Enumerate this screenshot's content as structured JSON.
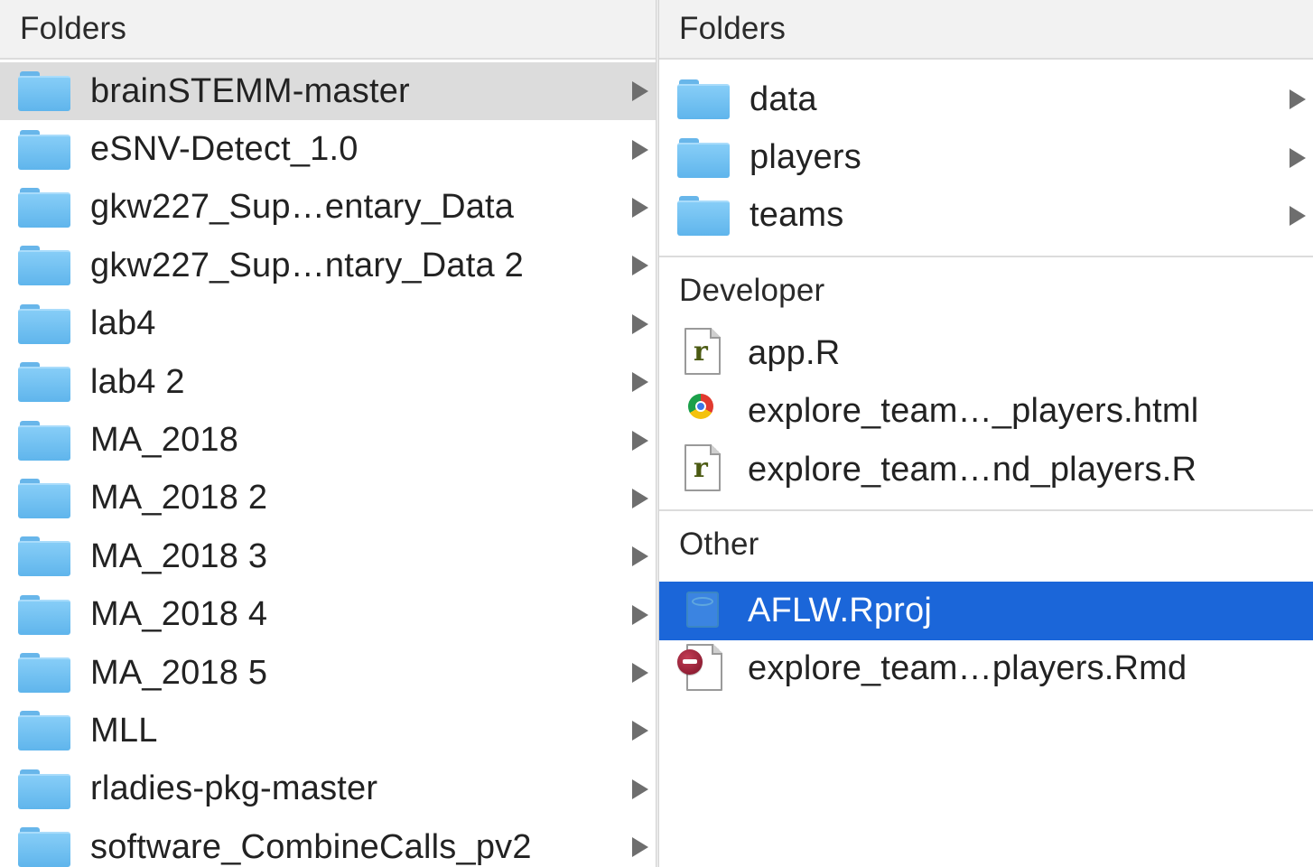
{
  "left_column": {
    "header": "Folders",
    "items": [
      {
        "label": "brainSTEMM-master",
        "selected": true
      },
      {
        "label": "eSNV-Detect_1.0"
      },
      {
        "label": "gkw227_Sup…entary_Data"
      },
      {
        "label": "gkw227_Sup…ntary_Data 2"
      },
      {
        "label": "lab4"
      },
      {
        "label": "lab4 2"
      },
      {
        "label": "MA_2018"
      },
      {
        "label": "MA_2018 2"
      },
      {
        "label": "MA_2018 3"
      },
      {
        "label": "MA_2018 4"
      },
      {
        "label": "MA_2018 5"
      },
      {
        "label": "MLL"
      },
      {
        "label": "rladies-pkg-master"
      },
      {
        "label": "software_CombineCalls_pv2"
      }
    ]
  },
  "right_column": {
    "folders_header": "Folders",
    "folders": [
      {
        "label": "data"
      },
      {
        "label": "players"
      },
      {
        "label": "teams"
      }
    ],
    "developer_header": "Developer",
    "developer_files": [
      {
        "label": "app.R",
        "icon": "r-script-icon"
      },
      {
        "label": "explore_team…_players.html",
        "icon": "chrome-html-icon"
      },
      {
        "label": "explore_team…nd_players.R",
        "icon": "r-script-icon"
      }
    ],
    "other_header": "Other",
    "other_files": [
      {
        "label": "AFLW.Rproj",
        "icon": "rproj-icon",
        "selected": true
      },
      {
        "label": "explore_team…players.Rmd",
        "icon": "rmd-icon"
      }
    ]
  },
  "colors": {
    "selection_active": "#1b66d9",
    "selection_inactive": "#dcdcdc",
    "folder_blue": "#6dbdf0"
  }
}
